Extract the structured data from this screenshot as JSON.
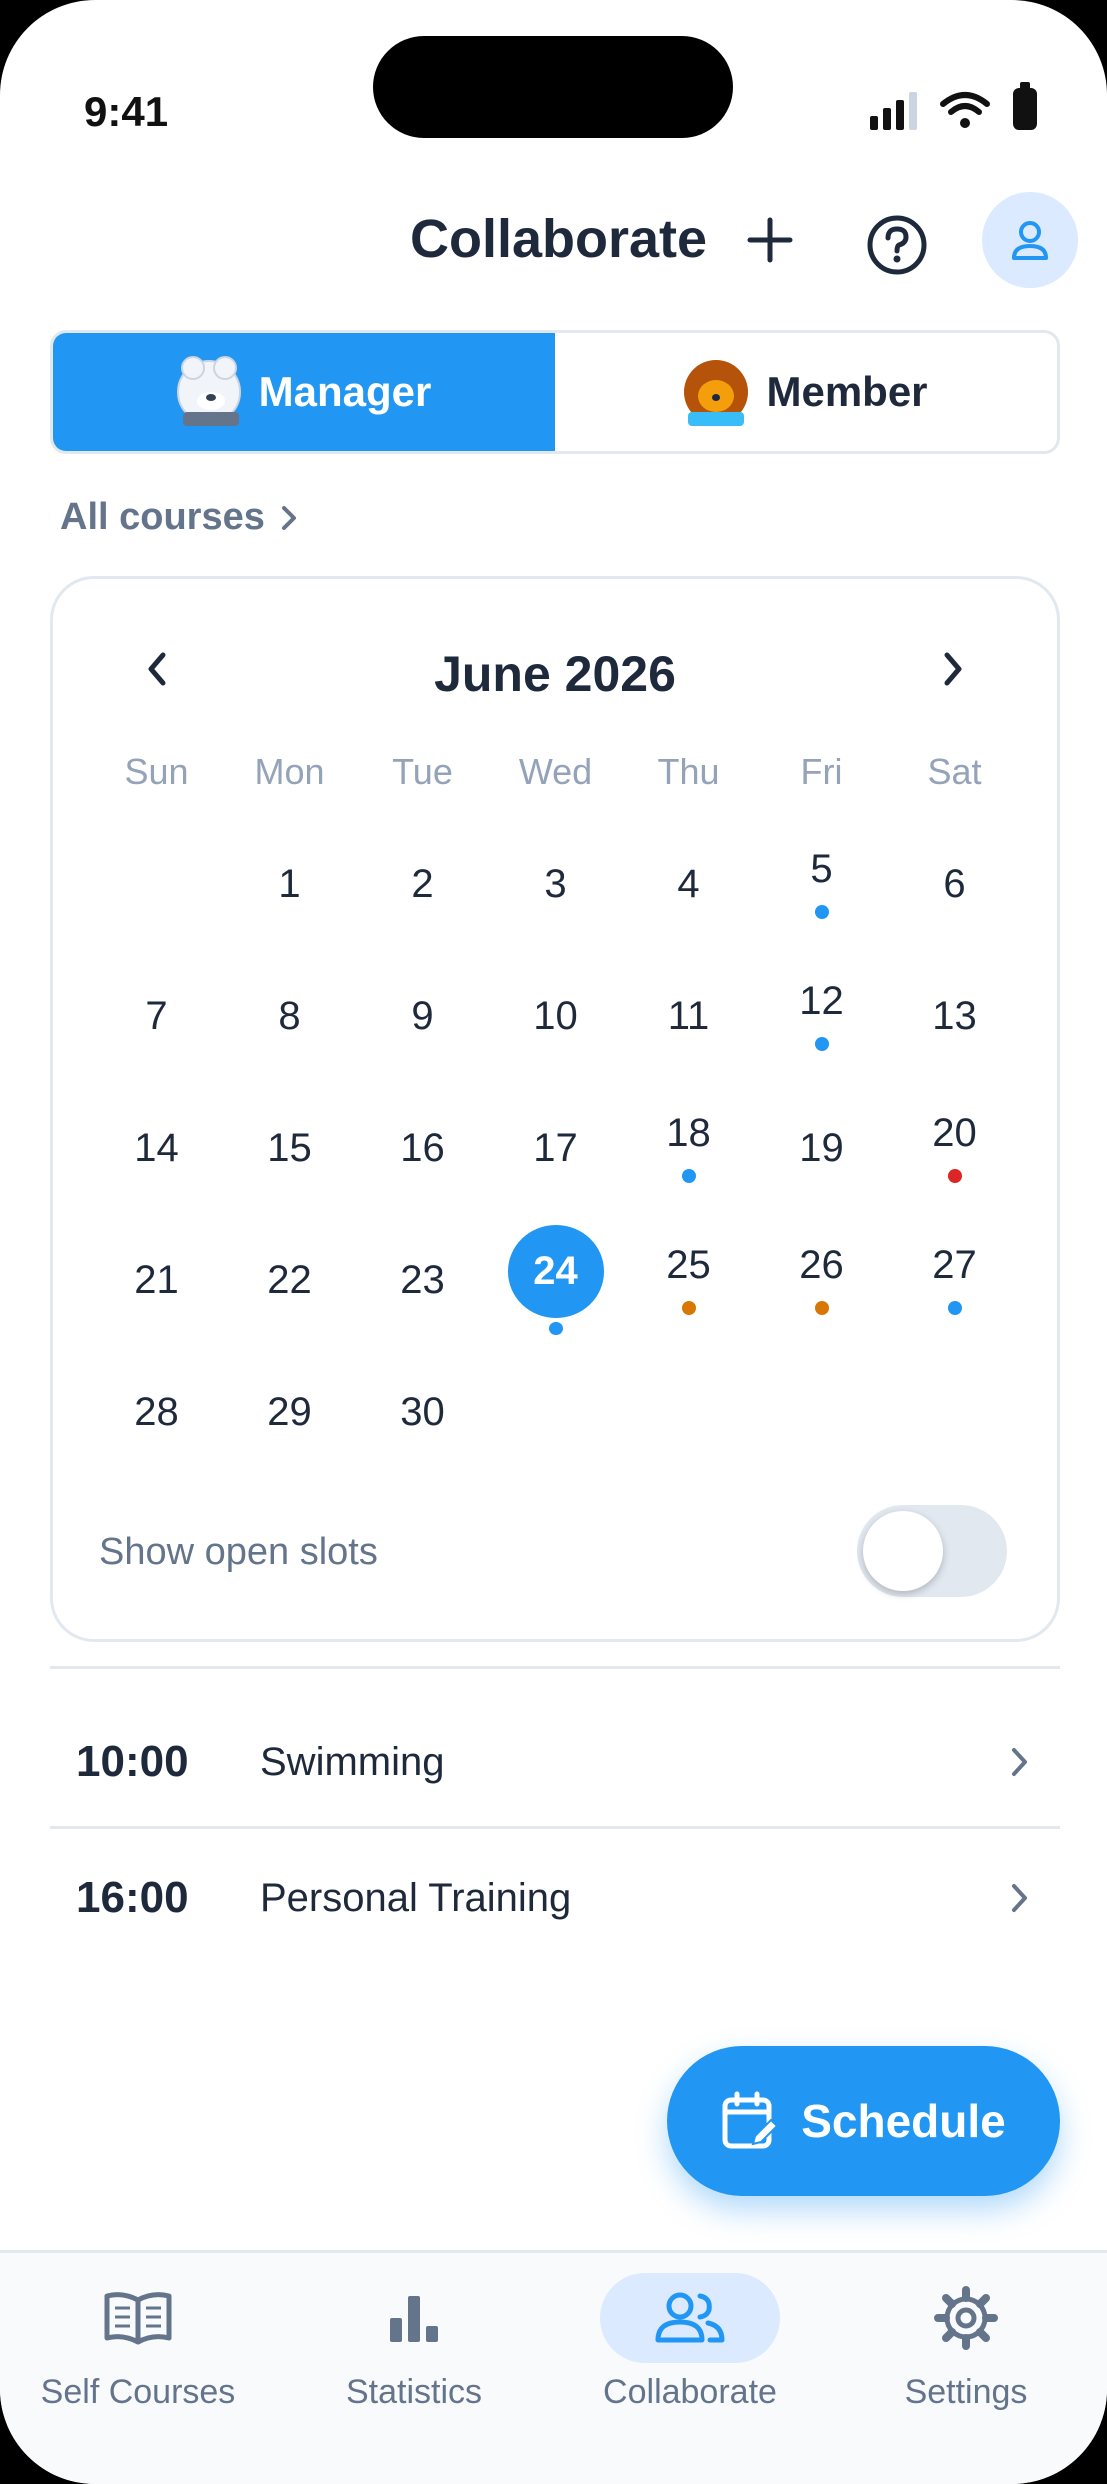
{
  "status": {
    "time": "9:41"
  },
  "header": {
    "title": "Collaborate",
    "add_icon": "plus-icon",
    "help_icon": "help-circle-icon",
    "profile_icon": "user-icon"
  },
  "roles": {
    "manager": {
      "label": "Manager",
      "avatar": "polar-bear"
    },
    "member": {
      "label": "Member",
      "avatar": "hedgehog"
    },
    "selected": "Manager"
  },
  "courses_filter": {
    "label": "All courses"
  },
  "calendar": {
    "month_label": "June 2026",
    "weekdays": [
      "Sun",
      "Mon",
      "Tue",
      "Wed",
      "Thu",
      "Fri",
      "Sat"
    ],
    "first_weekday_index": 1,
    "days_in_month": 30,
    "selected_day": 24,
    "markers": [
      {
        "day": 5,
        "color": "#2196f3"
      },
      {
        "day": 12,
        "color": "#2196f3"
      },
      {
        "day": 18,
        "color": "#2196f3"
      },
      {
        "day": 20,
        "color": "#dc2626"
      },
      {
        "day": 24,
        "color": "#2196f3"
      },
      {
        "day": 25,
        "color": "#d97706"
      },
      {
        "day": 26,
        "color": "#d97706"
      },
      {
        "day": 27,
        "color": "#2196f3"
      }
    ],
    "show_open_slots": {
      "label": "Show open slots",
      "on": false
    }
  },
  "sessions": [
    {
      "time": "10:00",
      "title": "Swimming"
    },
    {
      "time": "16:00",
      "title": "Personal Training"
    }
  ],
  "fab": {
    "label": "Schedule",
    "icon": "calendar-edit-icon"
  },
  "bottom_nav": {
    "items": [
      {
        "label": "Self Courses",
        "icon": "book-icon"
      },
      {
        "label": "Statistics",
        "icon": "bar-chart-icon"
      },
      {
        "label": "Collaborate",
        "icon": "users-icon"
      },
      {
        "label": "Settings",
        "icon": "gear-icon"
      }
    ],
    "active": "Collaborate"
  },
  "colors": {
    "accent": "#2196f3",
    "accent_light": "#dbeafe",
    "text": "#1e293b",
    "muted": "#64748b",
    "border": "#e2e8f0"
  }
}
